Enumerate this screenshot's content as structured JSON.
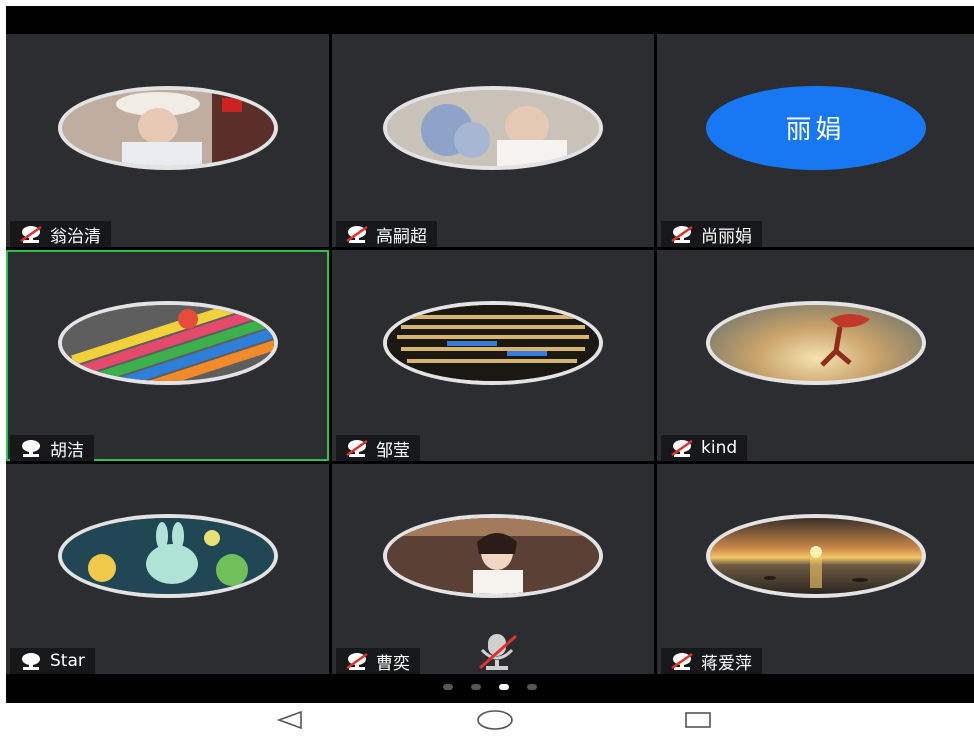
{
  "participants": [
    {
      "name": "翁治清",
      "muted": true,
      "avatar": "photo-portrait"
    },
    {
      "name": "高嗣超",
      "muted": true,
      "avatar": "photo-hydrangea"
    },
    {
      "name": "尚丽娟",
      "muted": true,
      "avatar": "text",
      "avatar_text": "丽娟"
    },
    {
      "name": "胡洁",
      "muted": false,
      "avatar": "photo-colorful-pencils",
      "active": true
    },
    {
      "name": "邹莹",
      "muted": true,
      "avatar": "photo-lights"
    },
    {
      "name": "kind",
      "muted": true,
      "avatar": "photo-dancer-sunset"
    },
    {
      "name": "Star",
      "muted": false,
      "avatar": "photo-cartoon-bunny"
    },
    {
      "name": "曹奕",
      "muted": true,
      "avatar": "photo-woman-smiling"
    },
    {
      "name": "蒋爱萍",
      "muted": true,
      "avatar": "photo-sunset-sea"
    }
  ],
  "pagination": {
    "pages": 4,
    "current": 3
  },
  "nav": {
    "back_icon": "triangle-back-icon",
    "home_icon": "circle-home-icon",
    "recents_icon": "square-recents-icon"
  },
  "colors": {
    "tile_bg": "#2b2d31",
    "active_border": "#2fbf4f",
    "text_avatar_bg": "#1878f3",
    "mute_red": "#e0312a"
  }
}
